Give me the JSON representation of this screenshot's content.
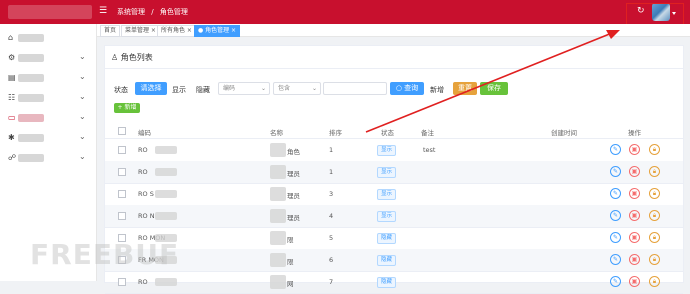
{
  "header": {
    "breadcrumb": [
      "系统管理",
      "/",
      "角色管理"
    ],
    "menu_icon": "☰",
    "refresh_icon": "↻"
  },
  "sidebar": {
    "items": [
      {
        "icon": "⌂",
        "chev": ""
      },
      {
        "icon": "⚙",
        "chev": "⌄"
      },
      {
        "icon": "▤",
        "chev": "⌄"
      },
      {
        "icon": "☷",
        "chev": "⌄"
      },
      {
        "icon": "▭",
        "chev": "⌄"
      },
      {
        "icon": "✱",
        "chev": "⌄"
      },
      {
        "icon": "☍",
        "chev": "⌄"
      }
    ]
  },
  "tabs": [
    {
      "label": "首页"
    },
    {
      "label": "菜单管理 ×"
    },
    {
      "label": "所有角色 ×"
    },
    {
      "label": "● 角色管理 ×"
    }
  ],
  "card": {
    "title": "角色列表",
    "filter": {
      "status_label": "状态",
      "select_label": "请选择",
      "show_label": "显示",
      "hide_label": "隐藏",
      "field_select": "编码",
      "op_select": "包含",
      "query_btn": "查询",
      "add_label": "新增",
      "reset_btn": "重置",
      "save_btn": "保存"
    },
    "add_button": "+ 新增",
    "columns": [
      "编码",
      "名称",
      "排序",
      "状态",
      "备注",
      "创建时间",
      "操作"
    ],
    "rows": [
      {
        "code": "RO",
        "name": "角色",
        "sort": "1",
        "status": "显示",
        "remark": "test"
      },
      {
        "code": "RO",
        "name": "理员",
        "sort": "1",
        "status": "显示",
        "remark": ""
      },
      {
        "code": "RO S",
        "name": "理员",
        "sort": "3",
        "status": "显示",
        "remark": ""
      },
      {
        "code": "RO N",
        "name": "理员",
        "sort": "4",
        "status": "显示",
        "remark": ""
      },
      {
        "code": "RO MON",
        "name": "限",
        "sort": "5",
        "status": "隐藏",
        "remark": ""
      },
      {
        "code": "FR MON",
        "name": "限",
        "sort": "6",
        "status": "隐藏",
        "remark": ""
      },
      {
        "code": "RO",
        "name": "网",
        "sort": "7",
        "status": "隐藏",
        "remark": ""
      }
    ]
  },
  "watermark": "FREEBUF",
  "colors": {
    "brand": "#c8102e",
    "primary": "#409eff",
    "warning": "#e6a23c",
    "success": "#67c23a",
    "danger": "#f56c6c"
  }
}
